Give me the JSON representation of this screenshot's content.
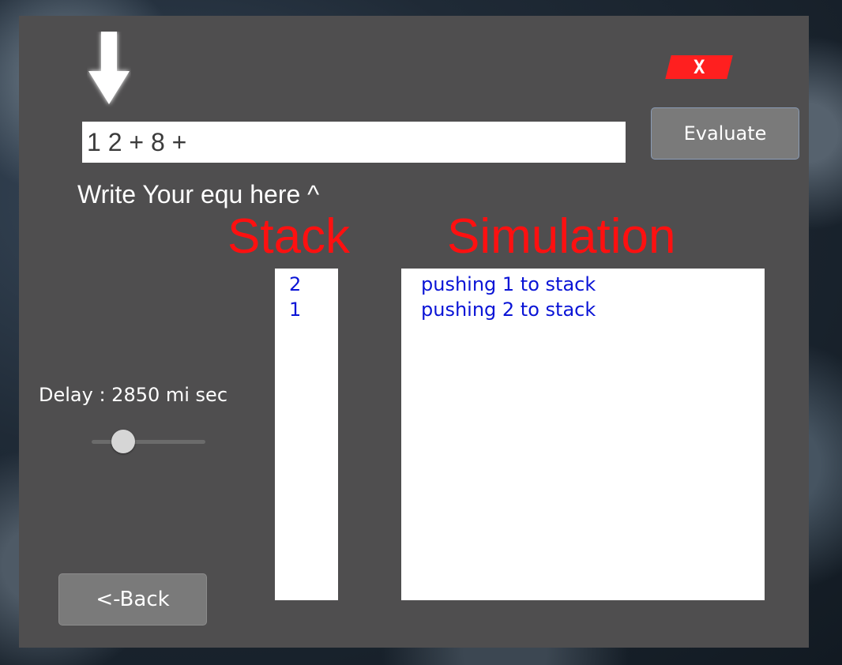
{
  "window": {
    "close_label": "X",
    "close_color": "#ff1f1f",
    "background": "#4f4e4f"
  },
  "equation": {
    "value": "1 2 + 8 +",
    "hint": "Write Your equ here ^"
  },
  "evaluate_button": "Evaluate",
  "headings": {
    "stack": "Stack",
    "simulation": "Simulation",
    "color": "#ff1010"
  },
  "stack": {
    "items": [
      "2",
      "1"
    ]
  },
  "simulation": {
    "lines": [
      "pushing 1 to stack",
      "pushing 2 to stack"
    ]
  },
  "delay": {
    "label": "Delay  : 2850 mi sec",
    "slider_fraction": 0.28
  },
  "back_button": "<-Back",
  "icons": {
    "arrow": "down-arrow-icon"
  }
}
